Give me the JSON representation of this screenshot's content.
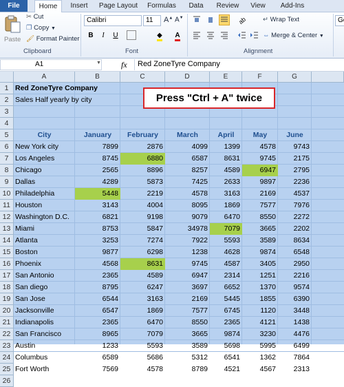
{
  "tabs": [
    "File",
    "Home",
    "Insert",
    "Page Layout",
    "Formulas",
    "Data",
    "Review",
    "View",
    "Add-Ins"
  ],
  "ribbon": {
    "paste": "Paste",
    "cut": "Cut",
    "copy": "Copy",
    "format_painter": "Format Painter",
    "clipboard": "Clipboard",
    "font_name": "Calibri",
    "font_size": "11",
    "font": "Font",
    "bold": "B",
    "italic": "I",
    "underline": "U",
    "wrap_text": "Wrap Text",
    "merge_center": "Merge & Center",
    "alignment": "Alignment",
    "number_format_partial": "Ge"
  },
  "formula_bar": {
    "name_box": "A1",
    "fx": "fx",
    "content": "Red ZoneTyre Company"
  },
  "columns": [
    "A",
    "B",
    "C",
    "D",
    "E",
    "F",
    "G"
  ],
  "rows": [
    "1",
    "2",
    "3",
    "4",
    "5",
    "6",
    "7",
    "8",
    "9",
    "10",
    "11",
    "12",
    "13",
    "14",
    "15",
    "16",
    "17",
    "18",
    "19",
    "20",
    "21",
    "22",
    "23",
    "24",
    "25",
    "26"
  ],
  "sheet": {
    "title": "Red ZoneTyre Company",
    "subtitle": "Sales Half yearly by city",
    "headers": [
      "City",
      "January",
      "February",
      "March",
      "April",
      "May",
      "June"
    ],
    "data": [
      [
        "New York city",
        "7899",
        "2876",
        "4099",
        "1399",
        "4578",
        "9743"
      ],
      [
        "Los Angeles",
        "8745",
        "6880",
        "6587",
        "8631",
        "9745",
        "2175"
      ],
      [
        "Chicago",
        "2565",
        "8896",
        "8257",
        "4589",
        "6947",
        "2795"
      ],
      [
        "Dallas",
        "4289",
        "5873",
        "7425",
        "2633",
        "9897",
        "2236"
      ],
      [
        "Philadelphia",
        "5448",
        "2219",
        "4578",
        "3163",
        "2169",
        "4537"
      ],
      [
        "Houston",
        "3143",
        "4004",
        "8095",
        "1869",
        "7577",
        "7976"
      ],
      [
        "Washington D.C.",
        "6821",
        "9198",
        "9079",
        "6470",
        "8550",
        "2272"
      ],
      [
        "Miami",
        "8753",
        "5847",
        "34978",
        "7079",
        "3665",
        "2202"
      ],
      [
        "Atlanta",
        "3253",
        "7274",
        "7922",
        "5593",
        "3589",
        "8634"
      ],
      [
        "Boston",
        "9877",
        "6298",
        "1238",
        "4628",
        "9874",
        "6548"
      ],
      [
        "Phoenix",
        "4568",
        "8631",
        "9745",
        "4587",
        "3405",
        "2950"
      ],
      [
        "San Antonio",
        "2365",
        "4589",
        "6947",
        "2314",
        "1251",
        "2216"
      ],
      [
        "San diego",
        "8795",
        "6247",
        "3697",
        "6652",
        "1370",
        "9574"
      ],
      [
        "San Jose",
        "6544",
        "3163",
        "2169",
        "5445",
        "1855",
        "6390"
      ],
      [
        "Jacksonville",
        "6547",
        "1869",
        "7577",
        "6745",
        "1120",
        "3448"
      ],
      [
        "Indianapolis",
        "2365",
        "6470",
        "8550",
        "2365",
        "4121",
        "1438"
      ],
      [
        "San Francisco",
        "8965",
        "7079",
        "3665",
        "9874",
        "3230",
        "4476"
      ],
      [
        "Austin",
        "1233",
        "5593",
        "3589",
        "5698",
        "5995",
        "6499"
      ],
      [
        "Columbus",
        "6589",
        "5686",
        "5312",
        "6541",
        "1362",
        "7864"
      ],
      [
        "Fort Worth",
        "7569",
        "4578",
        "8789",
        "4521",
        "4567",
        "2313"
      ]
    ]
  },
  "callout": "Press \"Ctrl + A\" twice",
  "colors": {
    "selection": "#b8d1f0",
    "highlight": "#a7d04c",
    "header_text": "#1f4f8f",
    "callout_border": "#d8262a"
  }
}
